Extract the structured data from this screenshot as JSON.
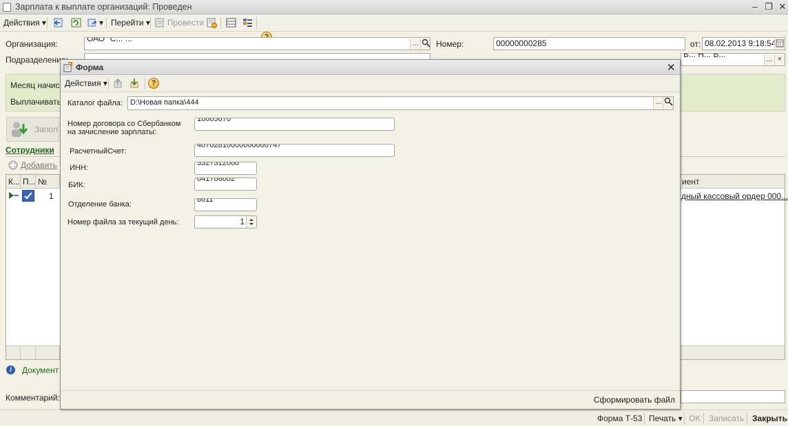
{
  "window": {
    "title": "Зарплата к выплате организаций: Проведен",
    "minimize": "–",
    "restore": "❐",
    "close": "✕"
  },
  "toolbar": {
    "actions": "Действия",
    "goto": "Перейти",
    "post": "Провести",
    "help": "?"
  },
  "header": {
    "org_label": "Организация:",
    "org_value": "ОАО \"С... ...\"",
    "dept_label": "Подразделение:",
    "dept_value": "",
    "number_label": "Номер:",
    "number_value": "00000000285",
    "date_label": "от:",
    "date_value": "08.02.2013  9:18:54",
    "responsible_value": "В... Н... В...",
    "ellipsis": "...",
    "clear": "×"
  },
  "green_panel": {
    "month_label": "Месяц начисл",
    "pay_label": "Выплачивать:"
  },
  "fill_button": "Запол",
  "employees": {
    "tab": "Сотрудники",
    "add": "Добавить",
    "columns": [
      "К...",
      "П...",
      "№"
    ],
    "right_column": "иент",
    "row": {
      "number": "1",
      "document": "дный кассовый ордер 000..."
    }
  },
  "document_info": "Документ",
  "comment_label": "Комментарий:",
  "statusbar": {
    "form_t53": "Форма Т-53",
    "print": "Печать",
    "ok": "OK",
    "save": "Записать",
    "close": "Закрыть"
  },
  "modal": {
    "title": "Форма",
    "close": "✕",
    "actions": "Действия",
    "help": "?",
    "catalog_label": "Каталог файла:",
    "catalog_value": "D:\\Новая папка\\444",
    "contract_label_1": "Номер договора со Сбербанком",
    "contract_label_2": "на зачисление зарплаты:",
    "contract_value": "10005070",
    "account_label": "РасчетныйСчет:",
    "account_value": "40702810000000000747",
    "inn_label": "ИНН:",
    "inn_value": "3327312000",
    "bik_label": "БИК:",
    "bik_value": "041708602",
    "branch_label": "Отделение банка:",
    "branch_value": "8611",
    "filenum_label": "Номер файла за текущий день:",
    "filenum_value": "1",
    "generate": "Сформировать файл"
  }
}
